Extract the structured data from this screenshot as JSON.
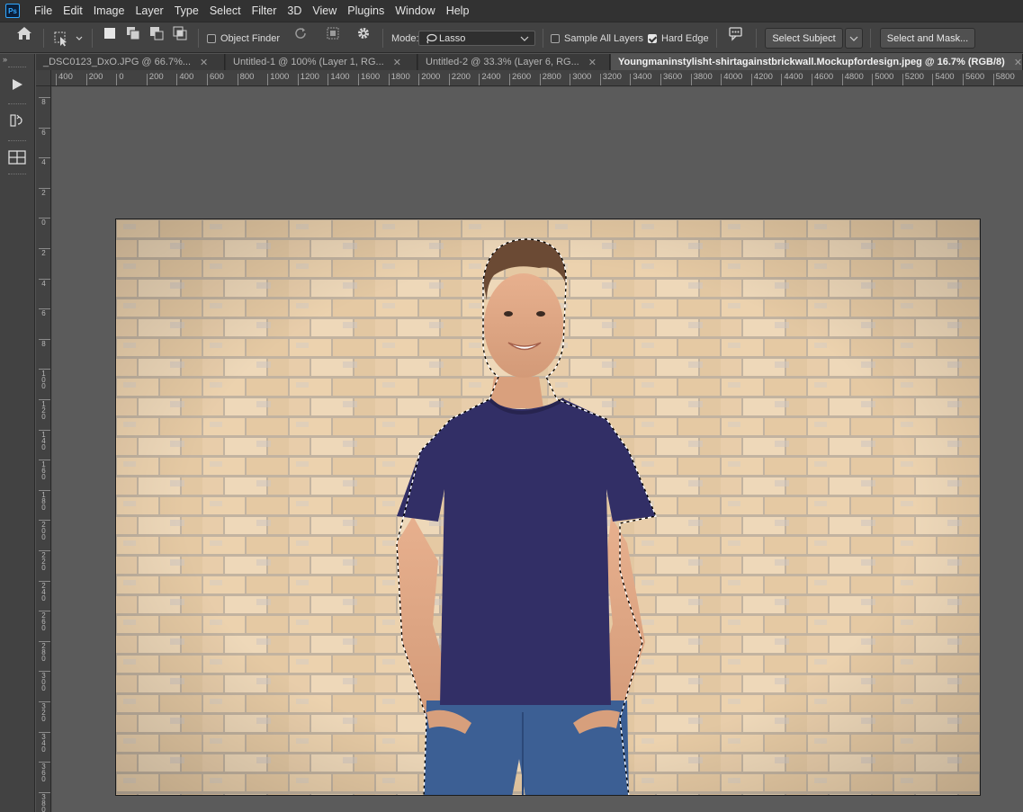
{
  "app": {
    "logo_text": "Ps"
  },
  "menu": [
    "File",
    "Edit",
    "Image",
    "Layer",
    "Type",
    "Select",
    "Filter",
    "3D",
    "View",
    "Plugins",
    "Window",
    "Help"
  ],
  "options_bar": {
    "object_finder_label": "Object Finder",
    "mode_label": "Mode:",
    "mode_value": "Lasso",
    "sample_all_layers_label": "Sample All Layers",
    "sample_all_layers_checked": false,
    "hard_edge_label": "Hard Edge",
    "hard_edge_checked": true,
    "select_subject_label": "Select Subject",
    "select_and_mask_label": "Select and Mask..."
  },
  "tabs": [
    {
      "label": "_DSC0123_DxO.JPG @ 66.7%...",
      "active": false
    },
    {
      "label": "Untitled-1 @ 100% (Layer 1, RG...",
      "active": false
    },
    {
      "label": "Untitled-2 @ 33.3% (Layer 6, RG...",
      "active": false
    },
    {
      "label": "Youngmaninstylisht-shirtagainstbrickwall.Mockupfordesign.jpeg @ 16.7% (RGB/8)",
      "active": true
    }
  ],
  "ruler_h_labels": [
    "400",
    "200",
    "0",
    "200",
    "400",
    "600",
    "800",
    "1000",
    "1200",
    "1400",
    "1600",
    "1800",
    "2000",
    "2200",
    "2400",
    "2600",
    "2800",
    "3000",
    "3200",
    "3400",
    "3600",
    "3800",
    "4000",
    "4200",
    "4400",
    "4600",
    "4800",
    "5000",
    "5200",
    "5400",
    "5600",
    "5800"
  ],
  "ruler_v_labels": [
    "8",
    "6",
    "4",
    "2",
    "0",
    "2",
    "4",
    "6",
    "8",
    "1 0 0",
    "1 2 0",
    "1 4 0",
    "1 6 0",
    "1 8 0",
    "2 0 0",
    "2 2 0",
    "2 4 0",
    "2 6 0",
    "2 8 0",
    "3 0 0",
    "3 2 0",
    "3 4 0",
    "3 6 0",
    "3 8 0"
  ],
  "colors": {
    "shirt": "#322f66",
    "brick": "#e9cfac",
    "mortar": "#c9b8a3",
    "jeans": "#3c5f94",
    "accent": "#31a8ff"
  }
}
